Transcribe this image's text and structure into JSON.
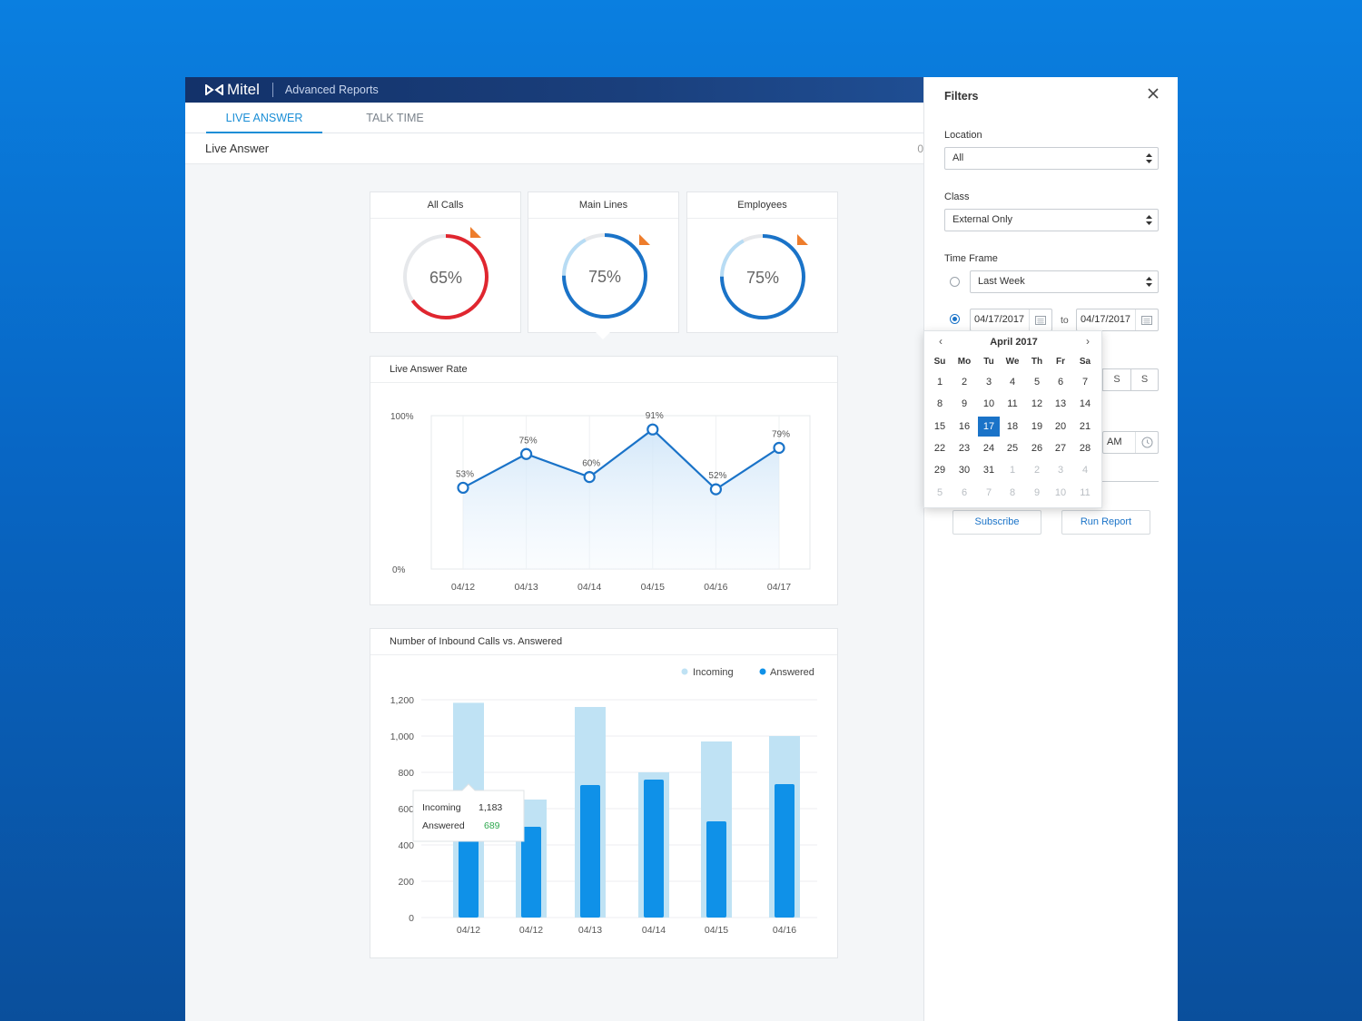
{
  "app": {
    "brand": "Mitel",
    "product": "Advanced Reports",
    "tabs": [
      {
        "label": "LIVE ANSWER",
        "active": true
      },
      {
        "label": "TALK TIME",
        "active": false
      }
    ],
    "section_title": "Live Answer",
    "section_count": "0"
  },
  "gauges": [
    {
      "title": "All Calls",
      "value": 65,
      "label": "65%",
      "color": "#e0262f"
    },
    {
      "title": "Main Lines",
      "value": 75,
      "label": "75%",
      "color": "#1a73c8"
    },
    {
      "title": "Employees",
      "value": 75,
      "label": "75%",
      "color": "#1a73c8"
    }
  ],
  "colors": {
    "accent": "#1a73c8",
    "incoming": "#bfe2f4",
    "answered": "#0f91e8",
    "flag": "#ee7d2c",
    "positive": "#2fa84f"
  },
  "chart_data": [
    {
      "type": "line",
      "title": "Live Answer Rate",
      "categories": [
        "04/12",
        "04/13",
        "04/14",
        "04/15",
        "04/16",
        "04/17"
      ],
      "values": [
        53,
        75,
        60,
        91,
        52,
        79
      ],
      "data_labels": [
        "53%",
        "75%",
        "60%",
        "91%",
        "52%",
        "79%"
      ],
      "ytick_labels": [
        "100%",
        "0%"
      ],
      "ylim": [
        0,
        100
      ],
      "grid": true
    },
    {
      "type": "bar",
      "title": "Number of Inbound Calls vs. Answered",
      "categories": [
        "04/12",
        "04/12",
        "04/13",
        "04/14",
        "04/15",
        "04/16"
      ],
      "series": [
        {
          "name": "Incoming",
          "values": [
            1183,
            650,
            1160,
            800,
            970,
            1000
          ]
        },
        {
          "name": "Answered",
          "values": [
            689,
            500,
            730,
            760,
            530,
            735
          ]
        }
      ],
      "yticks": [
        "1,200",
        "1,000",
        "800",
        "600",
        "400",
        "200",
        "0"
      ],
      "ylim": [
        0,
        1200
      ],
      "legend": "top-right",
      "tooltip": {
        "incoming_label": "Incoming",
        "incoming_value": "1,183",
        "answered_label": "Answered",
        "answered_value": "689"
      }
    }
  ],
  "filters": {
    "title": "Filters",
    "location": {
      "label": "Location",
      "value": "All"
    },
    "class": {
      "label": "Class",
      "value": "External Only"
    },
    "timeframe": {
      "label": "Time Frame",
      "preset": "Last Week",
      "from": "04/17/2017",
      "to_label": "to",
      "to": "04/17/2017"
    },
    "weekday_buttons": [
      "S",
      "S"
    ],
    "time_value": "AM",
    "subscribe": "Subscribe",
    "run_report": "Run Report"
  },
  "calendar": {
    "month": "April 2017",
    "weekdays": [
      "Su",
      "Mo",
      "Tu",
      "We",
      "Th",
      "Fr",
      "Sa"
    ],
    "weeks": [
      [
        [
          "1",
          0
        ],
        [
          "2",
          0
        ],
        [
          "3",
          0
        ],
        [
          "4",
          0
        ],
        [
          "5",
          0
        ],
        [
          "6",
          0
        ],
        [
          "7",
          0
        ]
      ],
      [
        [
          "8",
          0
        ],
        [
          "9",
          0
        ],
        [
          "10",
          0
        ],
        [
          "11",
          0
        ],
        [
          "12",
          0
        ],
        [
          "13",
          0
        ],
        [
          "14",
          0
        ]
      ],
      [
        [
          "15",
          0
        ],
        [
          "16",
          0
        ],
        [
          "17",
          2
        ],
        [
          "18",
          0
        ],
        [
          "19",
          0
        ],
        [
          "20",
          0
        ],
        [
          "21",
          0
        ]
      ],
      [
        [
          "22",
          0
        ],
        [
          "23",
          0
        ],
        [
          "24",
          0
        ],
        [
          "25",
          0
        ],
        [
          "26",
          0
        ],
        [
          "27",
          0
        ],
        [
          "28",
          0
        ]
      ],
      [
        [
          "29",
          0
        ],
        [
          "30",
          0
        ],
        [
          "31",
          0
        ],
        [
          "1",
          1
        ],
        [
          "2",
          1
        ],
        [
          "3",
          1
        ],
        [
          "4",
          1
        ]
      ],
      [
        [
          "5",
          1
        ],
        [
          "6",
          1
        ],
        [
          "7",
          1
        ],
        [
          "8",
          1
        ],
        [
          "9",
          1
        ],
        [
          "10",
          1
        ],
        [
          "11",
          1
        ]
      ]
    ]
  }
}
